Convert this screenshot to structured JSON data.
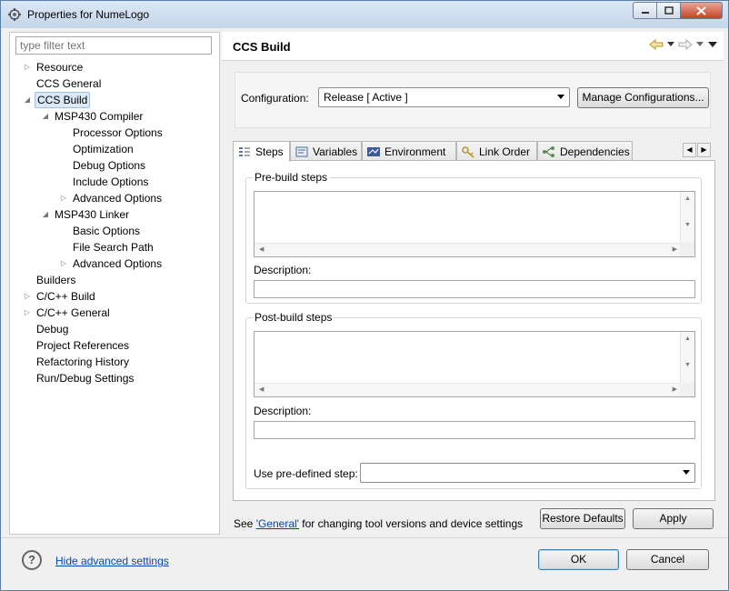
{
  "window": {
    "title": "Properties for NumeLogo"
  },
  "filter": {
    "placeholder": "type filter text"
  },
  "tree": [
    {
      "label": "Resource",
      "expander": "▷"
    },
    {
      "label": "CCS General",
      "expander": ""
    },
    {
      "label": "CCS Build",
      "expander": "◢",
      "selected": true
    },
    {
      "label": "MSP430 Compiler",
      "expander": "◢"
    },
    {
      "label": "Processor Options",
      "expander": ""
    },
    {
      "label": "Optimization",
      "expander": ""
    },
    {
      "label": "Debug Options",
      "expander": ""
    },
    {
      "label": "Include Options",
      "expander": ""
    },
    {
      "label": "Advanced Options",
      "expander": "▷"
    },
    {
      "label": "MSP430 Linker",
      "expander": "◢"
    },
    {
      "label": "Basic Options",
      "expander": ""
    },
    {
      "label": "File Search Path",
      "expander": ""
    },
    {
      "label": "Advanced Options",
      "expander": "▷"
    },
    {
      "label": "Builders",
      "expander": ""
    },
    {
      "label": "C/C++ Build",
      "expander": "▷"
    },
    {
      "label": "C/C++ General",
      "expander": "▷"
    },
    {
      "label": "Debug",
      "expander": ""
    },
    {
      "label": "Project References",
      "expander": ""
    },
    {
      "label": "Refactoring History",
      "expander": ""
    },
    {
      "label": "Run/Debug Settings",
      "expander": ""
    }
  ],
  "page": {
    "title": "CCS Build",
    "config_label": "Configuration:",
    "config_value": "Release  [ Active ]",
    "manage_button": "Manage Configurations..."
  },
  "tabs": [
    {
      "label": "Steps"
    },
    {
      "label": "Variables"
    },
    {
      "label": "Environment"
    },
    {
      "label": "Link Order"
    },
    {
      "label": "Dependencies"
    }
  ],
  "steps": {
    "pre_title": "Pre-build steps",
    "post_title": "Post-build steps",
    "description_label": "Description:",
    "predefined_label": "Use pre-defined step:",
    "predefined_value": ""
  },
  "footer": {
    "see_prefix": "See ",
    "general_link": "'General'",
    "see_suffix": " for changing tool versions and device settings",
    "restore_defaults": "Restore Defaults",
    "apply": "Apply"
  },
  "bottom": {
    "hide_advanced": "Hide advanced settings",
    "ok": "OK",
    "cancel": "Cancel"
  },
  "colors": {
    "link": "#0645ad",
    "selection_bg": "#dbe9f9",
    "close_button": "#c4432b"
  }
}
